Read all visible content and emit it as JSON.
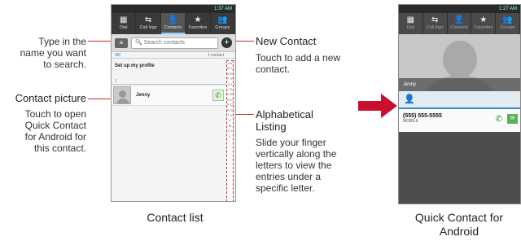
{
  "callouts": {
    "search": "Type in the name you want to search.",
    "contact_picture_title": "Contact picture",
    "contact_picture_desc": "Touch to open Quick Contact for Android for this contact.",
    "new_contact_title": "New Contact",
    "new_contact_desc": "Touch to add a new contact.",
    "alpha_title": "Alphabetical Listing",
    "alpha_desc": "Slide your finger vertically along the letters to view the entries under a specific letter."
  },
  "captions": {
    "left": "Contact list",
    "right": "Quick Contact for Android"
  },
  "phone1": {
    "status_time": "1:37 AM",
    "tabs": [
      {
        "icon": "▦",
        "label": "Dial"
      },
      {
        "icon": "⇆",
        "label": "Call logs"
      },
      {
        "icon": "👤",
        "label": "Contacts"
      },
      {
        "icon": "★",
        "label": "Favorites"
      },
      {
        "icon": "👥",
        "label": "Groups"
      }
    ],
    "search_placeholder": "Search contacts",
    "me_header": "ME",
    "contact_count": "1 contact",
    "profile_setup": "Set up my profile",
    "j_header": "J",
    "contact_name": "Jenny",
    "alphabet": "# A B C D E F G H I J K L M N O P Q R S T U V W X Y Z"
  },
  "phone2": {
    "status_time": "1:27 AM",
    "tabs": [
      {
        "icon": "▦",
        "label": "Dial"
      },
      {
        "icon": "⇆",
        "label": "Call logs"
      },
      {
        "icon": "👤",
        "label": "Contacts"
      },
      {
        "icon": "★",
        "label": "Favorites"
      },
      {
        "icon": "👥",
        "label": "Groups"
      }
    ],
    "contact_name": "Jenny",
    "phone_number": "(555) 555-5555",
    "phone_type": "MOBILE"
  },
  "colors": {
    "callout_line": "#d6262c",
    "arrow": "#c8102e"
  }
}
